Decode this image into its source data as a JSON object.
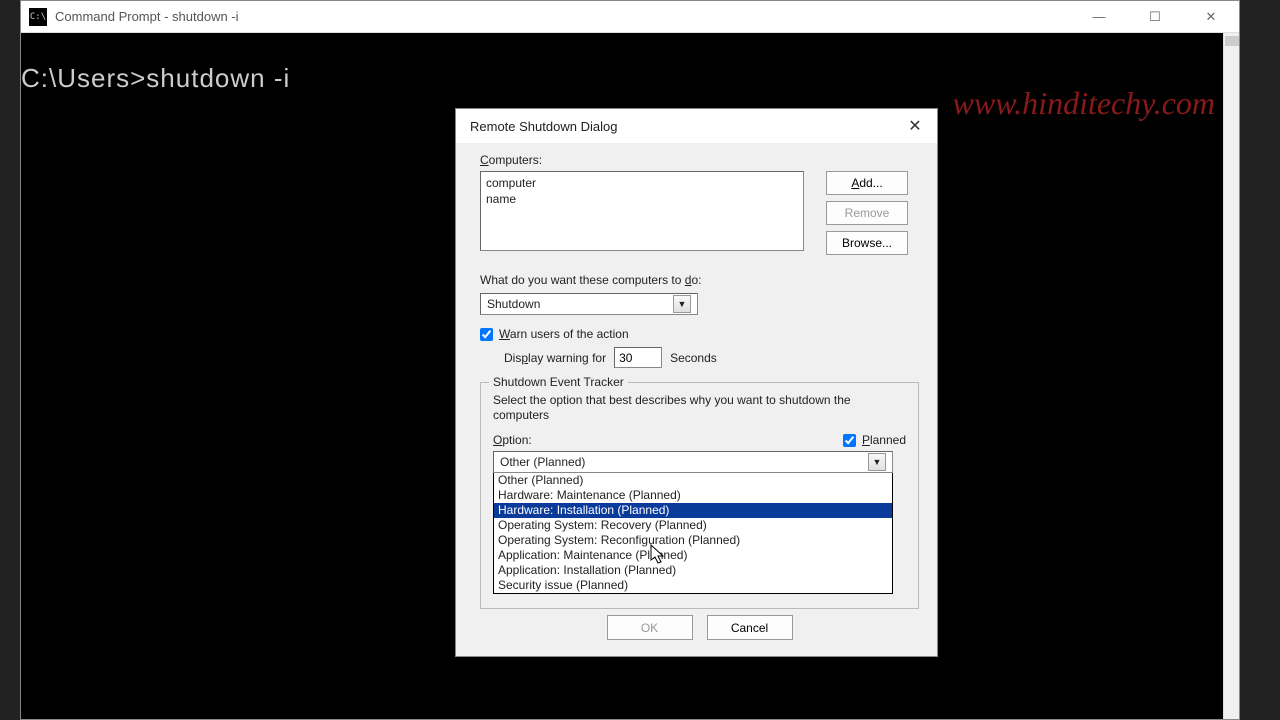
{
  "window": {
    "title": "Command Prompt - shutdown  -i"
  },
  "console": {
    "line": "C:\\Users>shutdown -i"
  },
  "watermark": "www.hinditechy.com",
  "dialog": {
    "title": "Remote Shutdown Dialog",
    "computers_label": "Computers:",
    "computers_list": "computer\nname",
    "add_btn": "Add...",
    "remove_btn": "Remove",
    "browse_btn": "Browse...",
    "what_label": "What do you want these computers to do:",
    "action_selected": "Shutdown",
    "warn_label": "Warn users of the action",
    "display_label": "Display warning for",
    "display_value": "30",
    "seconds_label": "Seconds",
    "tracker_legend": "Shutdown Event Tracker",
    "tracker_desc": "Select the option that best describes why you want to shutdown the computers",
    "option_label": "Option:",
    "planned_label": "Planned",
    "option_selected": "Other (Planned)",
    "options": [
      "Other (Planned)",
      "Hardware: Maintenance (Planned)",
      "Hardware: Installation (Planned)",
      "Operating System: Recovery (Planned)",
      "Operating System: Reconfiguration (Planned)",
      "Application: Maintenance (Planned)",
      "Application: Installation (Planned)",
      "Security issue (Planned)"
    ],
    "highlighted_index": 2,
    "ok_btn": "OK",
    "cancel_btn": "Cancel"
  }
}
